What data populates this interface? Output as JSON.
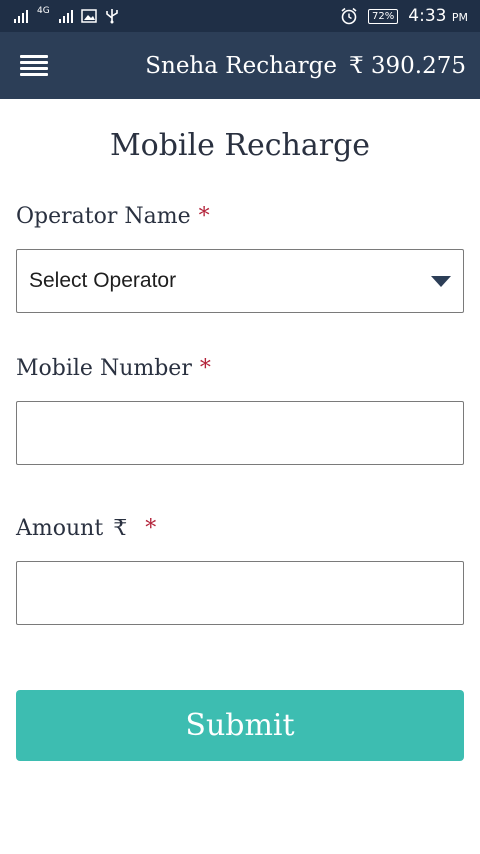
{
  "status_bar": {
    "network": "4G",
    "battery": "72%",
    "time": "4:33",
    "ampm": "PM"
  },
  "app_bar": {
    "title": "Sneha Recharge",
    "balance": "₹ 390.275"
  },
  "page": {
    "title": "Mobile Recharge"
  },
  "form": {
    "operator": {
      "label": "Operator Name",
      "required_mark": "*",
      "selected": "Select Operator"
    },
    "mobile": {
      "label": "Mobile Number",
      "required_mark": "*",
      "value": ""
    },
    "amount": {
      "label": "Amount",
      "currency": "₹",
      "required_mark": "*",
      "value": ""
    },
    "submit_label": "Submit"
  },
  "colors": {
    "status_bar": "#1f2f46",
    "app_bar": "#2c3e57",
    "accent": "#3dbdb1",
    "required": "#b3233a"
  }
}
